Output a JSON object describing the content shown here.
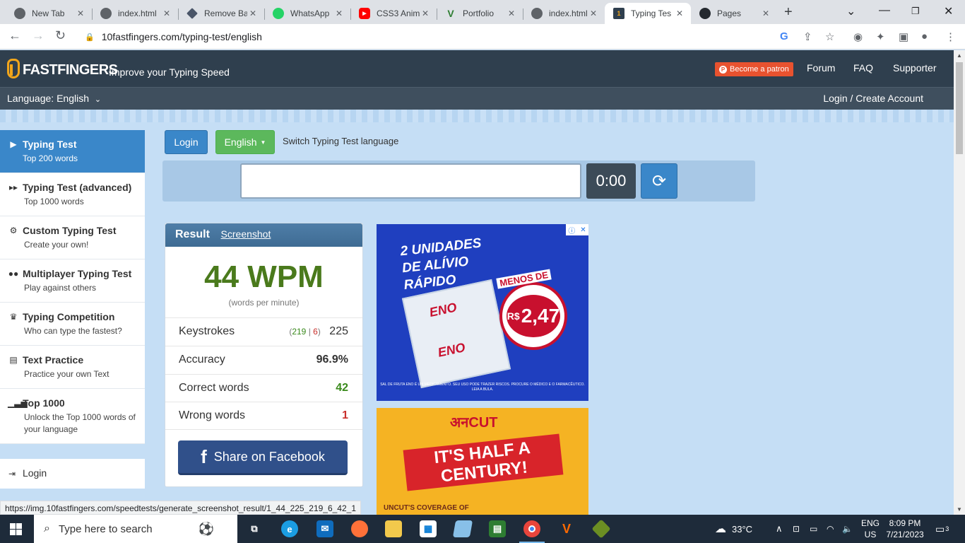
{
  "browser": {
    "tabs": [
      {
        "title": "New Tab",
        "icon": "chrome-icon",
        "color": "#5f6368",
        "glyph": ""
      },
      {
        "title": "index.html",
        "icon": "globe-icon",
        "color": "#5f6368",
        "glyph": ""
      },
      {
        "title": "Remove Ba",
        "icon": "removebg-icon",
        "color": "#4a5568",
        "glyph": ""
      },
      {
        "title": "WhatsApp",
        "icon": "whatsapp-icon",
        "color": "#25d366",
        "glyph": ""
      },
      {
        "title": "CSS3 Anim",
        "icon": "youtube-icon",
        "color": "#ff0000",
        "glyph": "▶"
      },
      {
        "title": "Portfolio",
        "icon": "v-logo-icon",
        "color": "#2e7d32",
        "glyph": "V"
      },
      {
        "title": "index.html",
        "icon": "globe-icon",
        "color": "#5f6368",
        "glyph": ""
      },
      {
        "title": "Typing Tes",
        "icon": "10fastfingers-icon",
        "color": "#2f3f4e",
        "glyph": "1"
      },
      {
        "title": "Pages",
        "icon": "github-icon",
        "color": "#24292f",
        "glyph": ""
      }
    ],
    "url": "10fastfingers.com/typing-test/english"
  },
  "site": {
    "logo_text": "FASTFINGERS",
    "slogan": "Improve your Typing Speed",
    "patron_label": "Become a patron",
    "nav": {
      "forum": "Forum",
      "faq": "FAQ",
      "supporter": "Supporter"
    },
    "language_label": "Language: English",
    "login_create": "Login / Create Account"
  },
  "sidebar": {
    "items": [
      {
        "title": "Typing Test",
        "sub": "Top 200 words",
        "icon": "play-icon",
        "glyph": "▶"
      },
      {
        "title": "Typing Test (advanced)",
        "sub": "Top 1000 words",
        "icon": "fast-forward-icon",
        "glyph": "⏩"
      },
      {
        "title": "Custom Typing Test",
        "sub": "Create your own!",
        "icon": "gears-icon",
        "glyph": "⚙"
      },
      {
        "title": "Multiplayer Typing Test",
        "sub": "Play against others",
        "icon": "users-icon",
        "glyph": "👥"
      },
      {
        "title": "Typing Competition",
        "sub": "Who can type the fastest?",
        "icon": "trophy-icon",
        "glyph": "🏆"
      },
      {
        "title": "Text Practice",
        "sub": "Practice your own Text",
        "icon": "document-icon",
        "glyph": "📄"
      },
      {
        "title": "Top 1000",
        "sub": "Unlock the Top 1000 words of your language",
        "icon": "signal-bars-icon",
        "glyph": "📶"
      }
    ],
    "login_label": "Login"
  },
  "controls": {
    "login_button": "Login",
    "language_button": "English",
    "switch_text": "Switch Typing Test language",
    "input_value": "",
    "timer": "0:00"
  },
  "result": {
    "title": "Result",
    "screenshot_link": "Screenshot",
    "wpm": "44 WPM",
    "wpm_sub": "(words per minute)",
    "keystrokes_label": "Keystrokes",
    "keystrokes_correct": "219",
    "keystrokes_sep": "|",
    "keystrokes_wrong": "6",
    "keystrokes_total": "225",
    "accuracy_label": "Accuracy",
    "accuracy_value": "96.9%",
    "correct_words_label": "Correct words",
    "correct_words_value": "42",
    "wrong_words_label": "Wrong words",
    "wrong_words_value": "1",
    "share_label": "Share on Facebook"
  },
  "ads": {
    "ad1_headline": "2 UNIDADES DE ALÍVIO RÁPIDO",
    "ad1_brand": "ENO",
    "ad1_offer": "MENOS DE",
    "ad1_price": "2,47",
    "ad1_legal": "SAL DE FRUTA ENO É UM MEDICAMENTO. SEU USO PODE TRAZER RISCOS. PROCURE O MÉDICO E O FARMACÊUTICO. LEIA A BULA.",
    "ad2_brand": "अनCUT",
    "ad2_banner": "IT'S HALF A CENTURY!",
    "ad2_foot": "UNCUT'S COVERAGE OF"
  },
  "status_url": "https://img.10fastfingers.com/speedtests/generate_screenshot_result/1_44_225_219_6_42_1",
  "taskbar": {
    "search_placeholder": "Type here to search",
    "weather": "33°C",
    "lang_top": "ENG",
    "lang_bottom": "US",
    "time": "8:09 PM",
    "date": "7/21/2023",
    "notifications": "3"
  },
  "colors": {
    "header": "#2f3f4e",
    "accent_blue": "#3a87c9",
    "green_button": "#5cb85c",
    "wpm_green": "#4a7a1c",
    "facebook": "#30508a"
  }
}
